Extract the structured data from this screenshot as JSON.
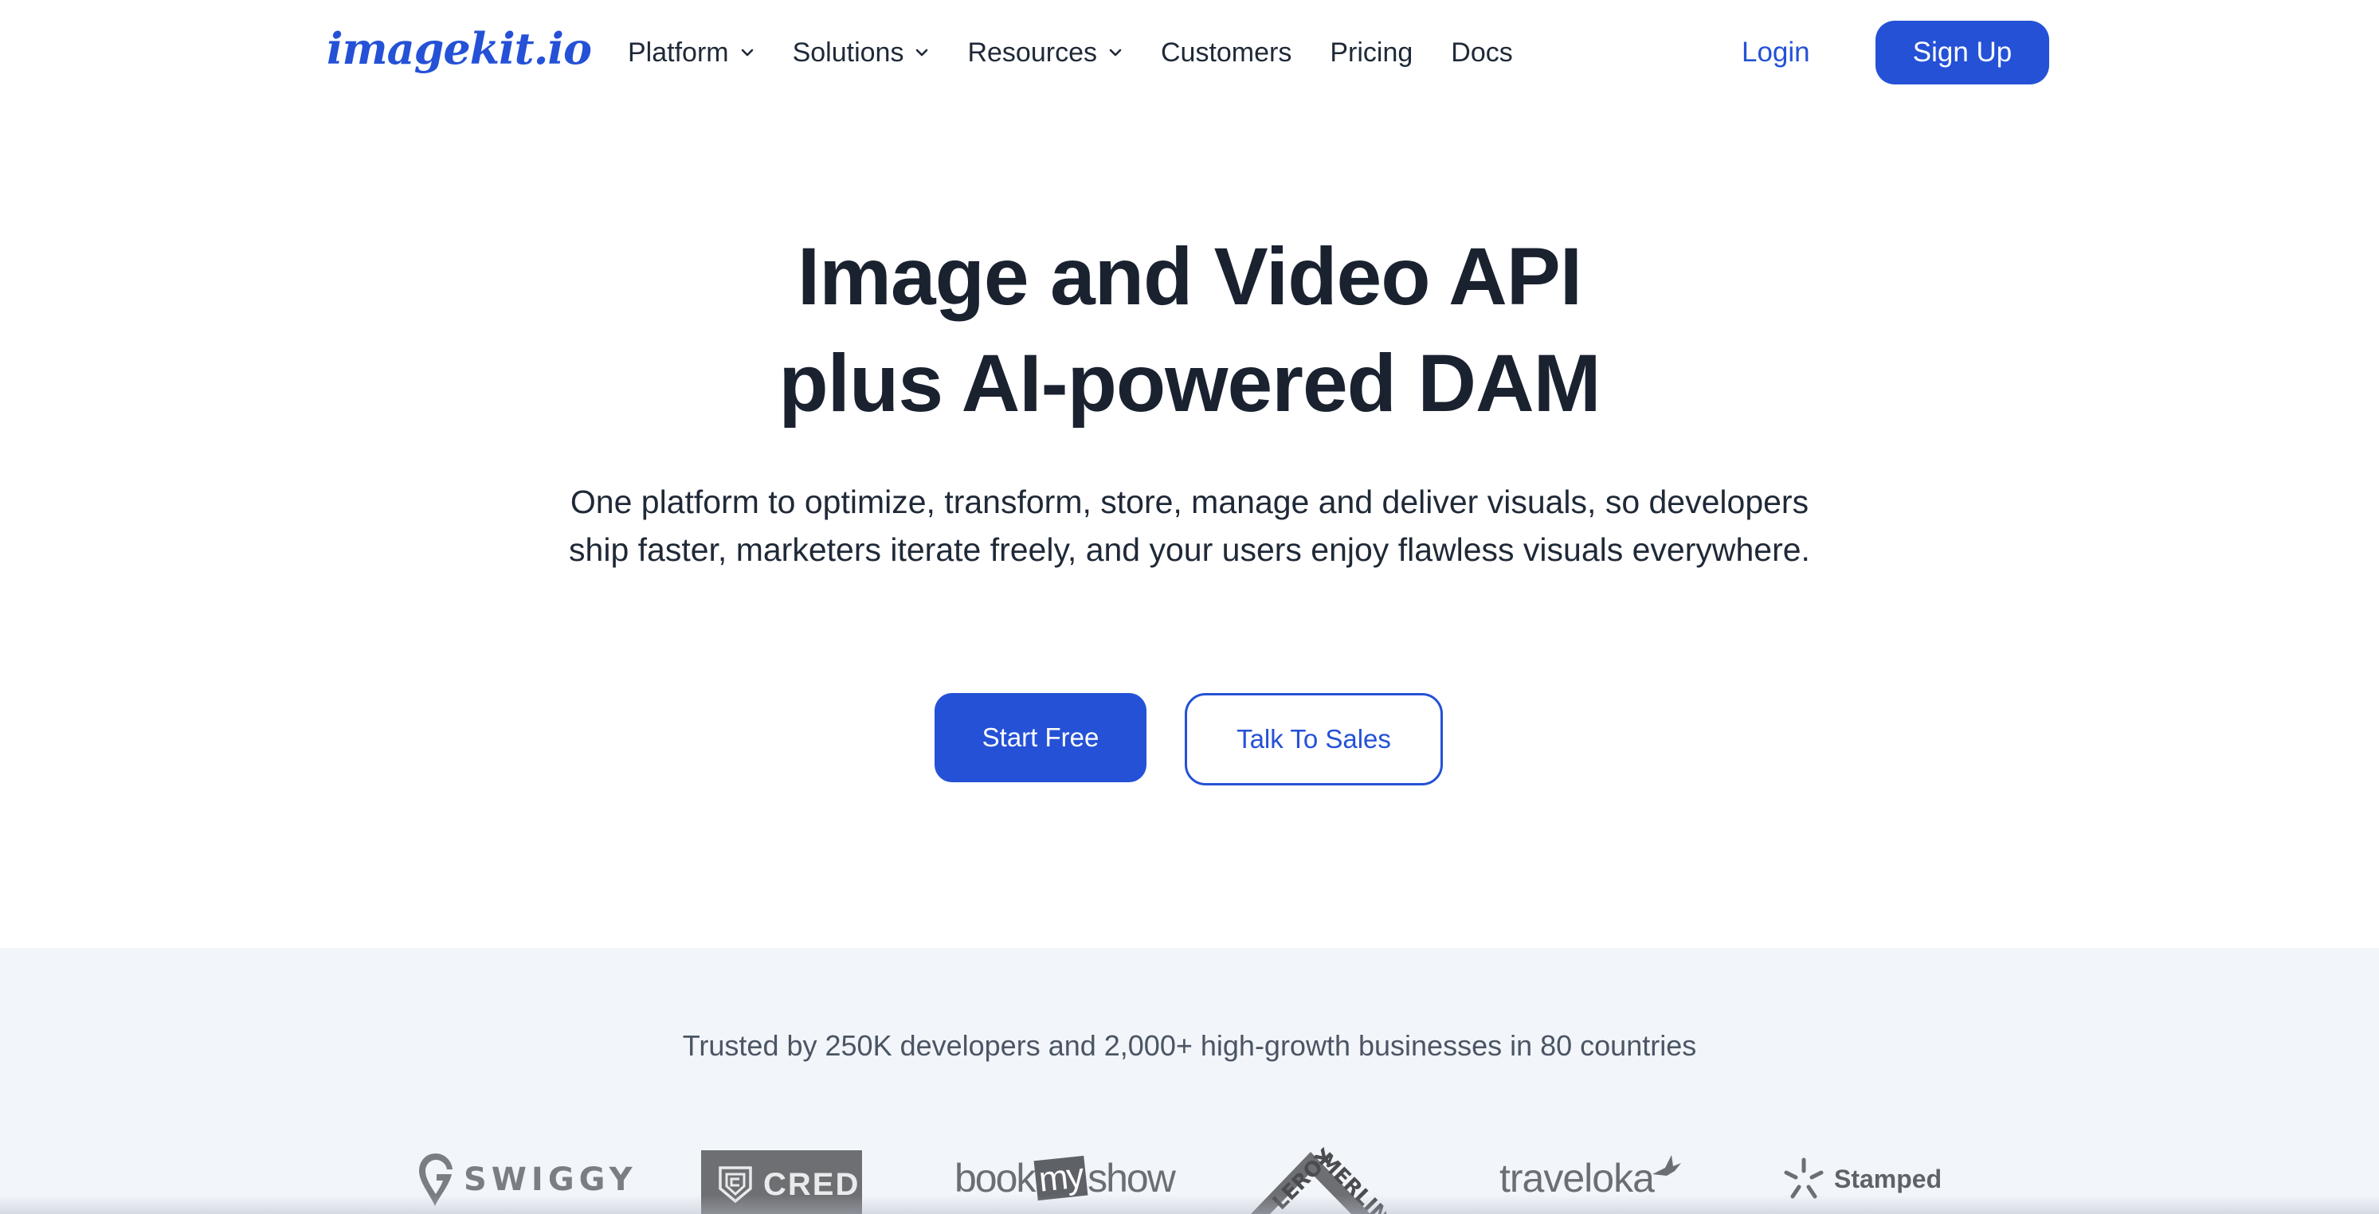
{
  "header": {
    "logo_text": "imagekit.io",
    "nav": [
      {
        "label": "Platform",
        "has_dropdown": true
      },
      {
        "label": "Solutions",
        "has_dropdown": true
      },
      {
        "label": "Resources",
        "has_dropdown": true
      },
      {
        "label": "Customers",
        "has_dropdown": false
      },
      {
        "label": "Pricing",
        "has_dropdown": false
      },
      {
        "label": "Docs",
        "has_dropdown": false
      }
    ],
    "login_label": "Login",
    "signup_label": "Sign Up"
  },
  "hero": {
    "title_line1": "Image and Video API",
    "title_line2": "plus AI-powered DAM",
    "subtitle": "One platform to optimize, transform, store, manage and deliver visuals, so developers ship faster, marketers iterate freely, and your users enjoy flawless visuals everywhere.",
    "cta_primary": "Start Free",
    "cta_secondary": "Talk To Sales"
  },
  "trust": {
    "text": "Trusted by 250K developers and 2,000+ high-growth businesses in 80 countries",
    "logos": [
      {
        "name": "SWIGGY",
        "icon": "swiggy-pin-icon"
      },
      {
        "name": "CRED",
        "icon": "cred-shield-icon"
      },
      {
        "name_parts": [
          "book",
          "my",
          "show"
        ]
      },
      {
        "name": "LEROY MERLIN"
      },
      {
        "name": "traveloka",
        "icon": "traveloka-bird-icon"
      },
      {
        "name": "Stamped",
        "icon": "stamped-star-icon"
      }
    ]
  },
  "colors": {
    "brand_blue": "#2451d6",
    "heading": "#1a2230",
    "trust_bg": "#f2f5fa",
    "logo_gray": "#6b6f75"
  }
}
